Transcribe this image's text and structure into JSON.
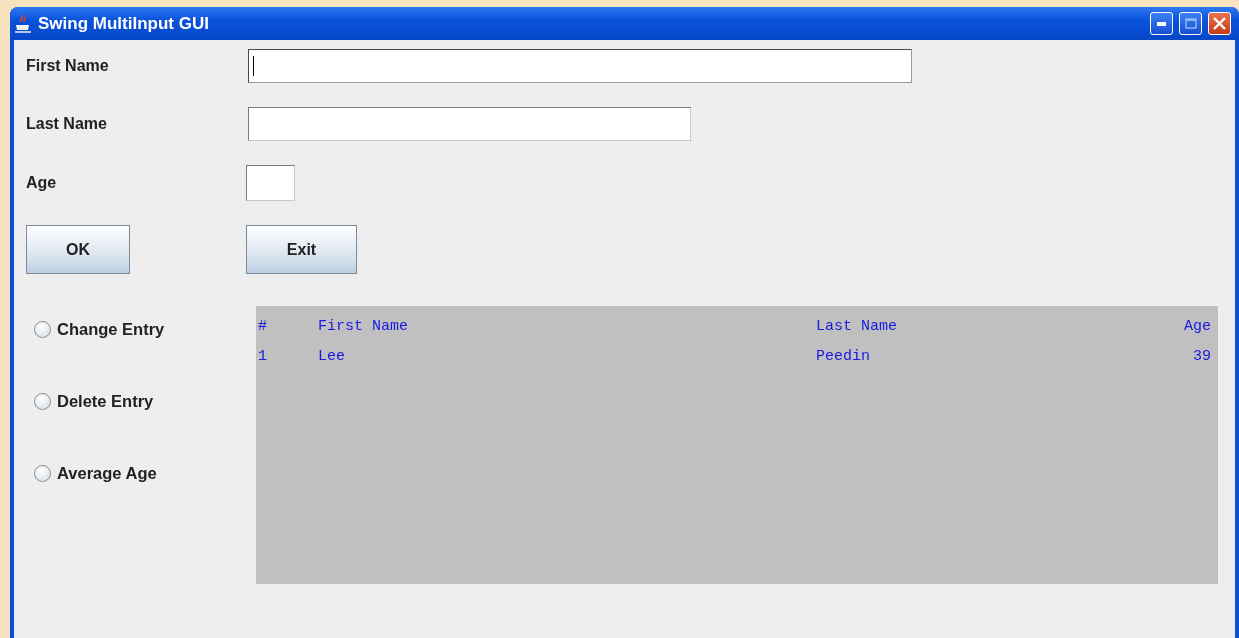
{
  "window": {
    "title": "Swing MultiInput GUI"
  },
  "fields": [
    {
      "label": "First Name",
      "focused": true
    },
    {
      "label": "Last Name",
      "focused": false
    },
    {
      "label": "Age",
      "focused": false
    }
  ],
  "buttons": [
    {
      "label": "OK"
    },
    {
      "label": "Exit"
    }
  ],
  "options": [
    {
      "label": "Change Entry",
      "selected": false
    },
    {
      "label": "Delete Entry",
      "selected": false
    },
    {
      "label": "Average Age",
      "selected": false
    }
  ],
  "table": {
    "columns": [
      "#",
      "First Name",
      "Last Name",
      "Age"
    ],
    "rows": [
      [
        "1",
        "Lee",
        "Peedin",
        "39"
      ]
    ]
  }
}
